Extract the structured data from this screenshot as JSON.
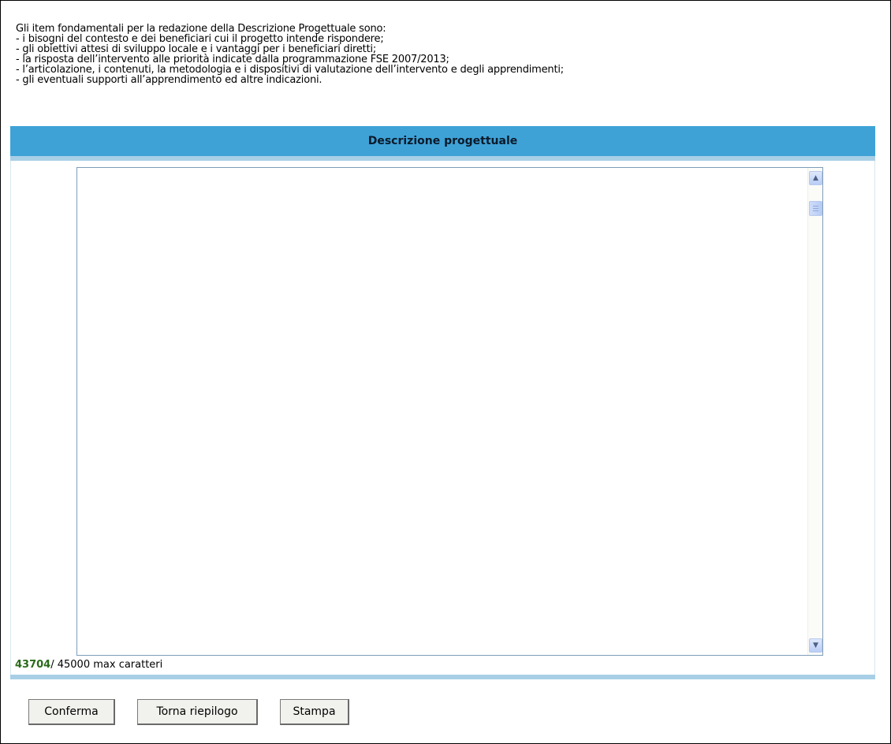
{
  "intro": {
    "lines": [
      "Gli item fondamentali per la redazione della Descrizione Progettuale sono:",
      "- i bisogni del contesto e dei beneficiari cui il progetto intende rispondere;",
      "- gli obiettivi attesi di sviluppo locale e i vantaggi per i beneficiari diretti;",
      "- la risposta dell’intervento alle priorità indicate dalla programmazione FSE 2007/2013;",
      "- l’articolazione, i contenuti, la metodologia e i dispositivi di valutazione dell’intervento e degli apprendimenti;",
      "- gli eventuali supporti all’apprendimento ed altre indicazioni."
    ]
  },
  "panel": {
    "title": "Descrizione progettuale",
    "textarea_value": ""
  },
  "counter": {
    "remaining": "43704",
    "max_text": "/ 45000 max caratteri"
  },
  "buttons": {
    "confirm": "Conferma",
    "back_summary": "Torna riepilogo",
    "print": "Stampa"
  },
  "colors": {
    "header_bg": "#3ea2d7",
    "header_border": "#a8cfe6",
    "counter_green": "#2a6a1a"
  },
  "icons": {
    "scroll_up": "▲",
    "scroll_down": "▼"
  }
}
